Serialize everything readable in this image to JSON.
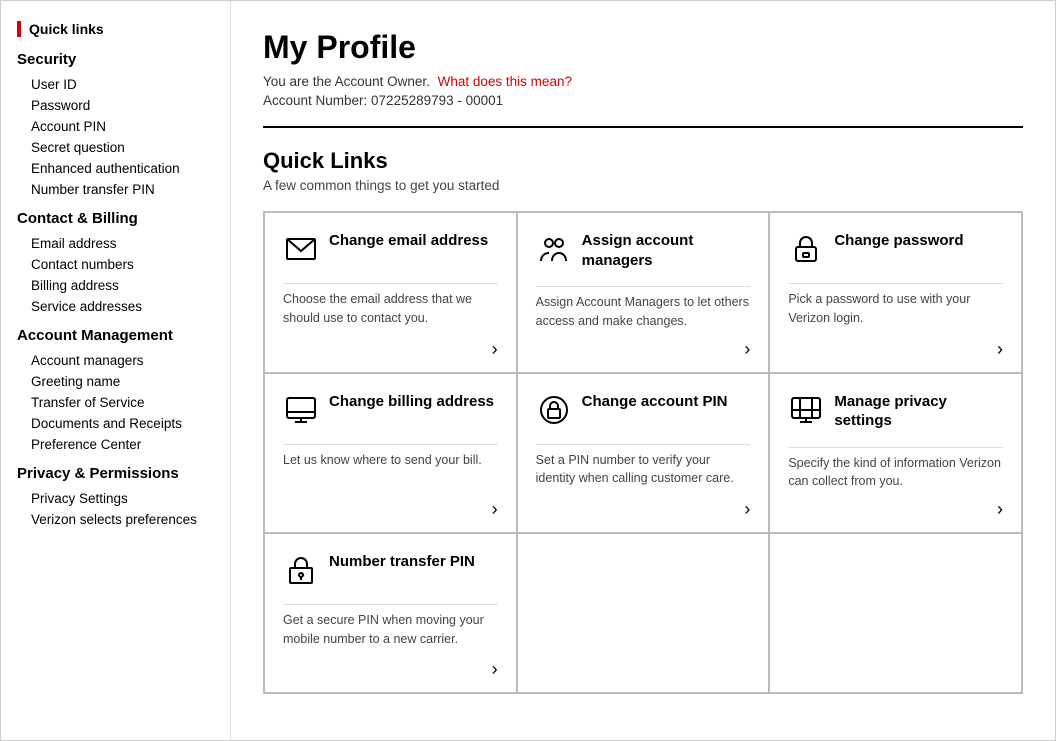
{
  "page": {
    "title": "My Profile",
    "account_owner_text": "You are the Account Owner.",
    "account_owner_link": "What does this mean?",
    "account_number": "Account Number: 07225289793 - 00001"
  },
  "quick_links_section": {
    "title": "Quick Links",
    "subtitle": "A few common things to get you started"
  },
  "sidebar": {
    "quick_links_label": "Quick links",
    "sections": [
      {
        "title": "Security",
        "items": [
          "User ID",
          "Password",
          "Account PIN",
          "Secret question",
          "Enhanced authentication",
          "Number transfer PIN"
        ]
      },
      {
        "title": "Contact & Billing",
        "items": [
          "Email address",
          "Contact numbers",
          "Billing address",
          "Service addresses"
        ]
      },
      {
        "title": "Account Management",
        "items": [
          "Account managers",
          "Greeting name",
          "Transfer of Service",
          "Documents and Receipts",
          "Preference Center"
        ]
      },
      {
        "title": "Privacy & Permissions",
        "items": [
          "Privacy Settings",
          "Verizon selects preferences"
        ]
      }
    ]
  },
  "cards": [
    {
      "id": "change-email",
      "title": "Change email address",
      "description": "Choose the email address that we should use to contact you.",
      "icon": "envelope"
    },
    {
      "id": "assign-account-managers",
      "title": "Assign account managers",
      "description": "Assign Account Managers to let others access and make changes.",
      "icon": "people"
    },
    {
      "id": "change-password",
      "title": "Change password",
      "description": "Pick a password to use with your Verizon login.",
      "icon": "lock"
    },
    {
      "id": "change-billing",
      "title": "Change billing address",
      "description": "Let us know where to send your bill.",
      "icon": "monitor"
    },
    {
      "id": "change-account-pin",
      "title": "Change account PIN",
      "description": "Set a PIN number to verify your identity when calling customer care.",
      "icon": "lock-circle"
    },
    {
      "id": "manage-privacy",
      "title": "Manage privacy settings",
      "description": "Specify the kind of information Verizon can collect from you.",
      "icon": "privacy-screen"
    },
    {
      "id": "number-transfer-pin",
      "title": "Number transfer PIN",
      "description": "Get a secure PIN when moving your mobile number to a new carrier.",
      "icon": "lock-square"
    }
  ],
  "arrow_label": "›"
}
